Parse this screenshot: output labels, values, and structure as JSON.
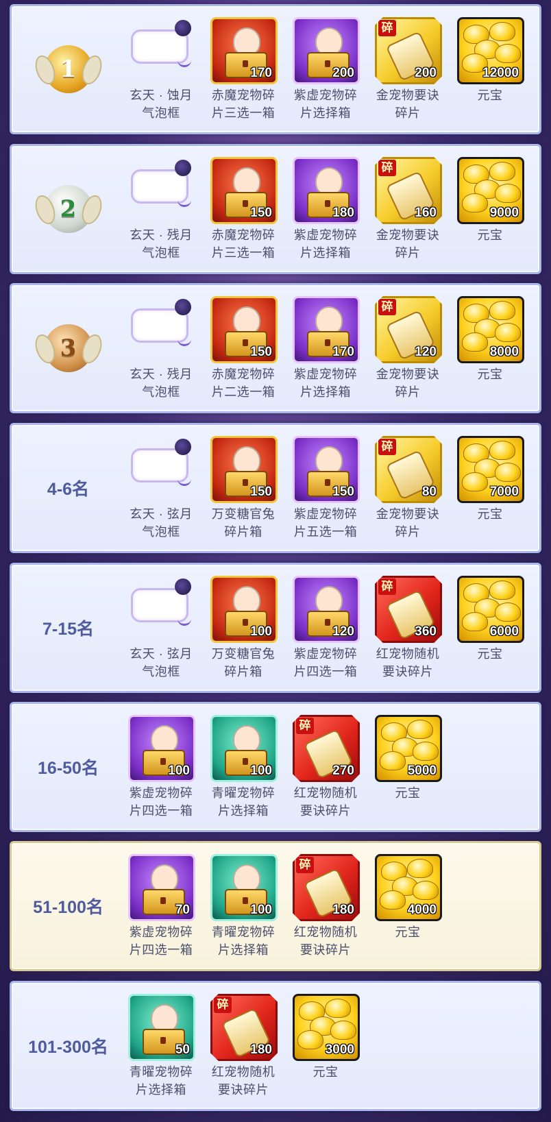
{
  "rows": [
    {
      "rank": "",
      "medal": "1",
      "highlight": false,
      "items": [
        {
          "type": "bubble",
          "name": "玄天 · 蚀月\n气泡框",
          "qty": "",
          "icon": "bubble-frame-icon"
        },
        {
          "type": "red",
          "name": "赤魔宠物碎\n片三选一箱",
          "qty": "170",
          "icon": "red-chest-icon"
        },
        {
          "type": "purple",
          "name": "紫虚宠物碎\n片选择箱",
          "qty": "200",
          "icon": "purple-chest-icon"
        },
        {
          "type": "gold",
          "name": "金宠物要诀\n碎片",
          "qty": "200",
          "icon": "gold-scroll-fragment-icon"
        },
        {
          "type": "ingot",
          "name": "元宝",
          "qty": "12000",
          "icon": "gold-ingot-icon"
        }
      ]
    },
    {
      "rank": "",
      "medal": "2",
      "highlight": false,
      "items": [
        {
          "type": "bubble",
          "name": "玄天 · 残月\n气泡框",
          "qty": "",
          "icon": "bubble-frame-icon"
        },
        {
          "type": "red",
          "name": "赤魔宠物碎\n片三选一箱",
          "qty": "150",
          "icon": "red-chest-icon"
        },
        {
          "type": "purple",
          "name": "紫虚宠物碎\n片选择箱",
          "qty": "180",
          "icon": "purple-chest-icon"
        },
        {
          "type": "gold",
          "name": "金宠物要诀\n碎片",
          "qty": "160",
          "icon": "gold-scroll-fragment-icon"
        },
        {
          "type": "ingot",
          "name": "元宝",
          "qty": "9000",
          "icon": "gold-ingot-icon"
        }
      ]
    },
    {
      "rank": "",
      "medal": "3",
      "highlight": false,
      "items": [
        {
          "type": "bubble",
          "name": "玄天 · 残月\n气泡框",
          "qty": "",
          "icon": "bubble-frame-icon"
        },
        {
          "type": "red",
          "name": "赤魔宠物碎\n片二选一箱",
          "qty": "150",
          "icon": "red-chest-icon"
        },
        {
          "type": "purple",
          "name": "紫虚宠物碎\n片选择箱",
          "qty": "170",
          "icon": "purple-chest-icon"
        },
        {
          "type": "gold",
          "name": "金宠物要诀\n碎片",
          "qty": "120",
          "icon": "gold-scroll-fragment-icon"
        },
        {
          "type": "ingot",
          "name": "元宝",
          "qty": "8000",
          "icon": "gold-ingot-icon"
        }
      ]
    },
    {
      "rank": "4-6名",
      "medal": "",
      "highlight": false,
      "items": [
        {
          "type": "bubble",
          "name": "玄天 · 弦月\n气泡框",
          "qty": "",
          "icon": "bubble-frame-icon"
        },
        {
          "type": "red",
          "name": "万变糖官兔\n碎片箱",
          "qty": "150",
          "icon": "red-chest-icon"
        },
        {
          "type": "purple",
          "name": "紫虚宠物碎\n片五选一箱",
          "qty": "150",
          "icon": "purple-chest-icon"
        },
        {
          "type": "gold",
          "name": "金宠物要诀\n碎片",
          "qty": "80",
          "icon": "gold-scroll-fragment-icon"
        },
        {
          "type": "ingot",
          "name": "元宝",
          "qty": "7000",
          "icon": "gold-ingot-icon"
        }
      ]
    },
    {
      "rank": "7-15名",
      "medal": "",
      "highlight": false,
      "items": [
        {
          "type": "bubble",
          "name": "玄天 · 弦月\n气泡框",
          "qty": "",
          "icon": "bubble-frame-icon"
        },
        {
          "type": "red",
          "name": "万变糖官兔\n碎片箱",
          "qty": "100",
          "icon": "red-chest-icon"
        },
        {
          "type": "purple",
          "name": "紫虚宠物碎\n片四选一箱",
          "qty": "120",
          "icon": "purple-chest-icon"
        },
        {
          "type": "redfrag",
          "name": "红宠物随机\n要诀碎片",
          "qty": "360",
          "icon": "red-scroll-fragment-icon"
        },
        {
          "type": "ingot",
          "name": "元宝",
          "qty": "6000",
          "icon": "gold-ingot-icon"
        }
      ]
    },
    {
      "rank": "16-50名",
      "medal": "",
      "highlight": false,
      "items": [
        {
          "type": "purple",
          "name": "紫虚宠物碎\n片四选一箱",
          "qty": "100",
          "icon": "purple-chest-icon"
        },
        {
          "type": "teal",
          "name": "青曜宠物碎\n片选择箱",
          "qty": "100",
          "icon": "teal-chest-icon"
        },
        {
          "type": "redfrag",
          "name": "红宠物随机\n要诀碎片",
          "qty": "270",
          "icon": "red-scroll-fragment-icon"
        },
        {
          "type": "ingot",
          "name": "元宝",
          "qty": "5000",
          "icon": "gold-ingot-icon"
        }
      ]
    },
    {
      "rank": "51-100名",
      "medal": "",
      "highlight": true,
      "items": [
        {
          "type": "purple",
          "name": "紫虚宠物碎\n片四选一箱",
          "qty": "70",
          "icon": "purple-chest-icon"
        },
        {
          "type": "teal",
          "name": "青曜宠物碎\n片选择箱",
          "qty": "100",
          "icon": "teal-chest-icon"
        },
        {
          "type": "redfrag",
          "name": "红宠物随机\n要诀碎片",
          "qty": "180",
          "icon": "red-scroll-fragment-icon"
        },
        {
          "type": "ingot",
          "name": "元宝",
          "qty": "4000",
          "icon": "gold-ingot-icon"
        }
      ]
    },
    {
      "rank": "101-300名",
      "medal": "",
      "highlight": false,
      "items": [
        {
          "type": "teal",
          "name": "青曜宠物碎\n片选择箱",
          "qty": "50",
          "icon": "teal-chest-icon"
        },
        {
          "type": "redfrag",
          "name": "红宠物随机\n要诀碎片",
          "qty": "180",
          "icon": "red-scroll-fragment-icon"
        },
        {
          "type": "ingot",
          "name": "元宝",
          "qty": "3000",
          "icon": "gold-ingot-icon"
        }
      ]
    }
  ]
}
